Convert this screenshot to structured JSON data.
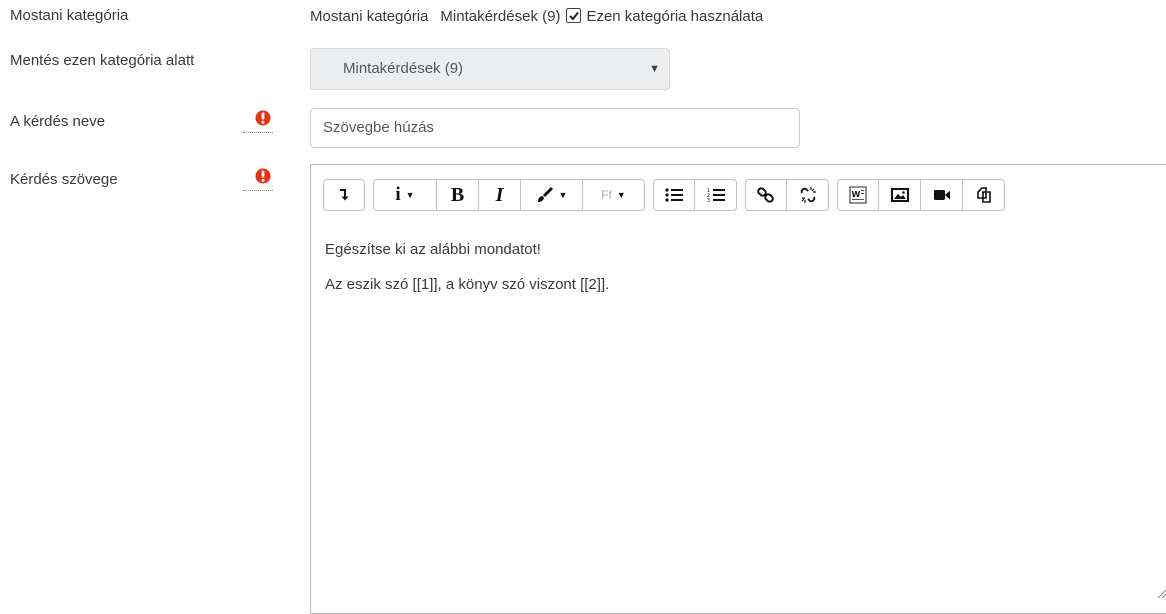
{
  "fields": {
    "current_category": {
      "label": "Mostani kategória",
      "value_label": "Mostani kategória",
      "value": "Mintakérdések (9)",
      "checkbox_label": "Ezen kategória használata",
      "checkbox_checked": true
    },
    "save_category": {
      "label": "Mentés ezen kategória alatt",
      "selected": "Mintakérdések (9)"
    },
    "question_name": {
      "label": "A kérdés neve",
      "value": "Szövegbe húzás",
      "required": true
    },
    "question_text": {
      "label": "Kérdés szövege",
      "required": true
    }
  },
  "editor": {
    "toolbar": {
      "font_label": "Ff",
      "groups": [
        [
          "collapse-icon"
        ],
        [
          "info-icon",
          "bold-icon",
          "italic-icon",
          "brush-icon",
          "font-icon"
        ],
        [
          "unordered-list-icon",
          "ordered-list-icon"
        ],
        [
          "link-icon",
          "unlink-icon"
        ],
        [
          "word-paste-icon",
          "image-icon",
          "video-icon",
          "copy-icon"
        ]
      ]
    },
    "paragraphs": [
      "Egészítse ki az alábbi mondatot!",
      "Az eszik szó [[1]], a könyv szó viszont [[2]]."
    ]
  },
  "colors": {
    "required": "#e8310f",
    "select_bg": "#eceeef",
    "text": "#373a3c"
  }
}
